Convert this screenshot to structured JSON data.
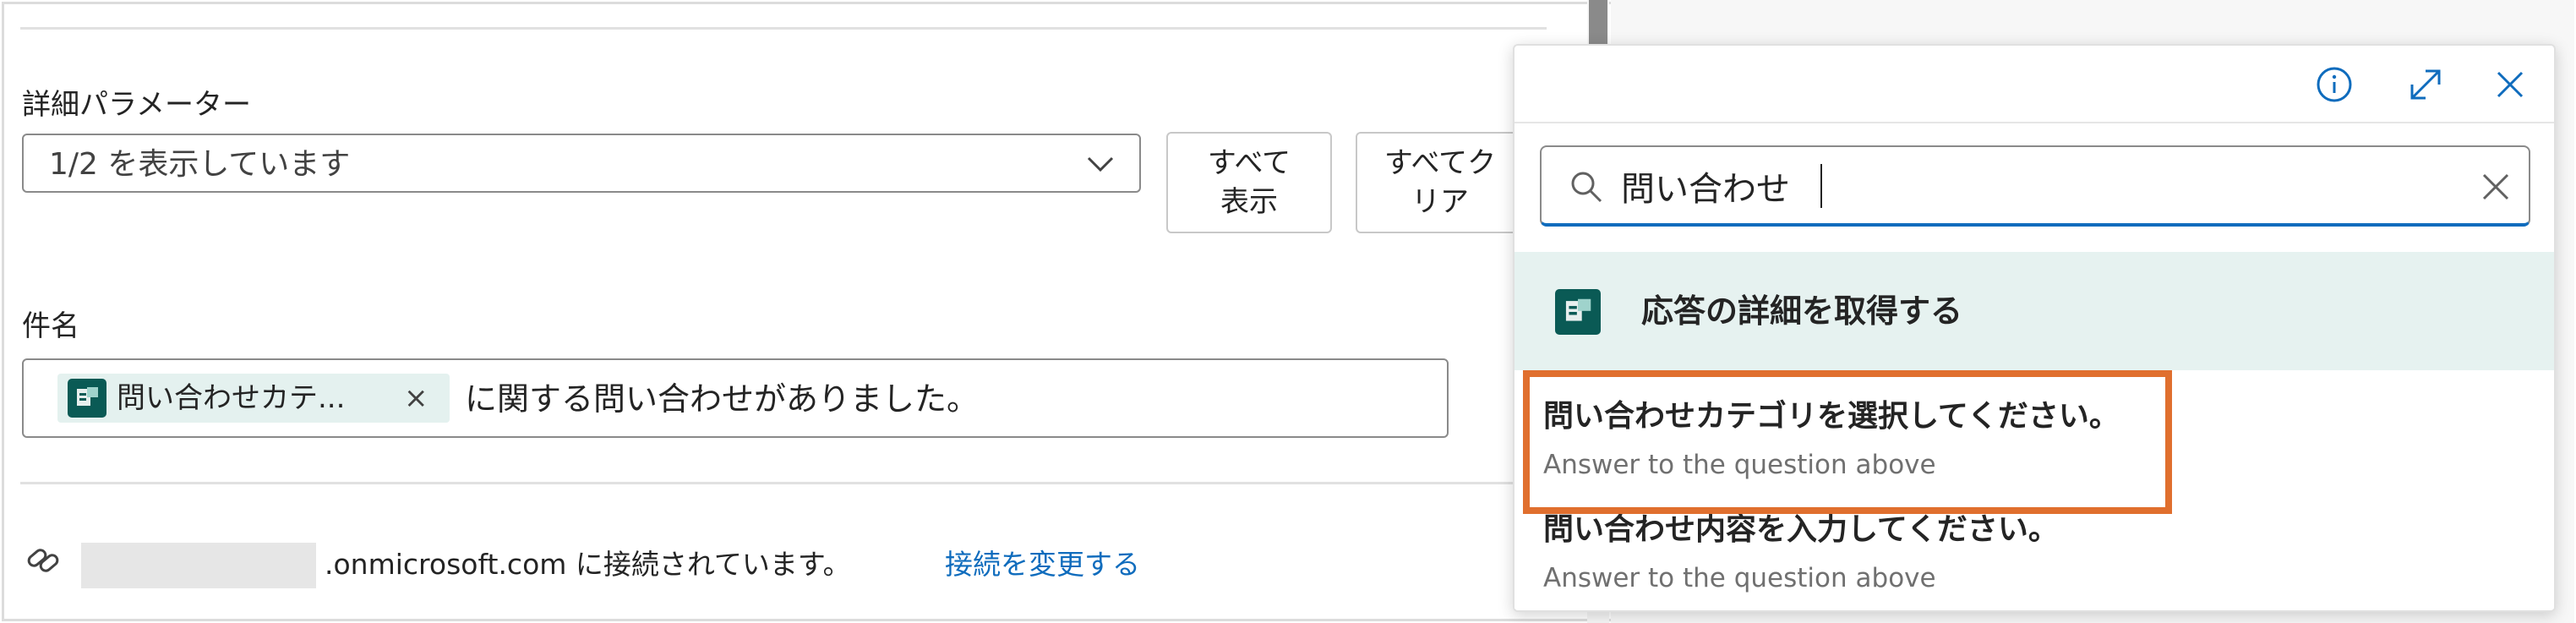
{
  "advanced": {
    "label": "詳細パラメーター",
    "selected": "1/2 を表示しています",
    "show_all_line1": "すべて",
    "show_all_line2": "表示",
    "clear_all_line1": "すべてク",
    "clear_all_line2": "リア"
  },
  "subject": {
    "label": "件名",
    "token_label": "問い合わせカテ...",
    "token_remove": "×",
    "text": "に関する問い合わせがありました。"
  },
  "connection": {
    "text": ".onmicrosoft.com に接続されています。",
    "change_link": "接続を変更する"
  },
  "popup": {
    "search": {
      "value": "問い合わせ"
    },
    "group": {
      "label": "応答の詳細を取得する"
    },
    "items": [
      {
        "title": "問い合わせカテゴリを選択してください。",
        "subtitle": "Answer to the question above"
      },
      {
        "title": "問い合わせ内容を入力してください。",
        "subtitle": "Answer to the question above"
      }
    ]
  },
  "icons": {
    "info": "info-icon",
    "expand": "expand-icon",
    "close": "close-icon",
    "search": "search-icon",
    "clear": "clear-icon",
    "chevron": "chevron-down-icon",
    "link": "link-icon",
    "app": "forms-app-icon"
  },
  "colors": {
    "accent": "#0f6cbd",
    "app_icon": "#0a5a55",
    "token_bg": "#e4f1ef",
    "group_bg": "#e6f2f0",
    "highlight": "#e06f2e",
    "subtext": "#707070"
  }
}
